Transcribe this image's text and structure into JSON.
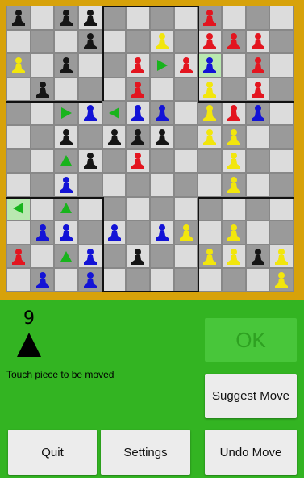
{
  "board": {
    "rows": 12,
    "cols": 12,
    "colors": {
      "light": "#dcdcdc",
      "dark": "#9a9a9a",
      "highlight": "#b9e8b0",
      "frame": "#d7a20a"
    },
    "pieces": [
      {
        "r": 0,
        "c": 0,
        "color": "black",
        "kind": "pawn"
      },
      {
        "r": 0,
        "c": 2,
        "color": "black",
        "kind": "pawn"
      },
      {
        "r": 0,
        "c": 3,
        "color": "black",
        "kind": "pawn"
      },
      {
        "r": 0,
        "c": 8,
        "color": "red",
        "kind": "pawn"
      },
      {
        "r": 1,
        "c": 3,
        "color": "black",
        "kind": "pawn"
      },
      {
        "r": 1,
        "c": 6,
        "color": "yellow",
        "kind": "pawn"
      },
      {
        "r": 1,
        "c": 8,
        "color": "red",
        "kind": "pawn"
      },
      {
        "r": 1,
        "c": 9,
        "color": "red",
        "kind": "pawn"
      },
      {
        "r": 1,
        "c": 10,
        "color": "red",
        "kind": "pawn"
      },
      {
        "r": 2,
        "c": 0,
        "color": "yellow",
        "kind": "pawn"
      },
      {
        "r": 2,
        "c": 2,
        "color": "black",
        "kind": "pawn"
      },
      {
        "r": 2,
        "c": 5,
        "color": "red",
        "kind": "pawn"
      },
      {
        "r": 2,
        "c": 6,
        "color": "green",
        "kind": "arrow-right"
      },
      {
        "r": 2,
        "c": 7,
        "color": "red",
        "kind": "pawn"
      },
      {
        "r": 2,
        "c": 8,
        "color": "blue",
        "kind": "pawn",
        "highlight": true
      },
      {
        "r": 2,
        "c": 10,
        "color": "red",
        "kind": "pawn"
      },
      {
        "r": 3,
        "c": 1,
        "color": "black",
        "kind": "pawn"
      },
      {
        "r": 3,
        "c": 5,
        "color": "red",
        "kind": "pawn"
      },
      {
        "r": 3,
        "c": 8,
        "color": "yellow",
        "kind": "pawn"
      },
      {
        "r": 3,
        "c": 10,
        "color": "red",
        "kind": "pawn"
      },
      {
        "r": 4,
        "c": 2,
        "color": "green",
        "kind": "arrow-right"
      },
      {
        "r": 4,
        "c": 3,
        "color": "blue",
        "kind": "pawn"
      },
      {
        "r": 4,
        "c": 4,
        "color": "green",
        "kind": "arrow-left"
      },
      {
        "r": 4,
        "c": 5,
        "color": "blue",
        "kind": "pawn"
      },
      {
        "r": 4,
        "c": 6,
        "color": "blue",
        "kind": "pawn"
      },
      {
        "r": 4,
        "c": 8,
        "color": "yellow",
        "kind": "pawn"
      },
      {
        "r": 4,
        "c": 9,
        "color": "red",
        "kind": "pawn"
      },
      {
        "r": 4,
        "c": 10,
        "color": "blue",
        "kind": "pawn"
      },
      {
        "r": 5,
        "c": 2,
        "color": "black",
        "kind": "pawn"
      },
      {
        "r": 5,
        "c": 4,
        "color": "black",
        "kind": "pawn"
      },
      {
        "r": 5,
        "c": 5,
        "color": "black",
        "kind": "pawn"
      },
      {
        "r": 5,
        "c": 6,
        "color": "black",
        "kind": "pawn"
      },
      {
        "r": 5,
        "c": 8,
        "color": "yellow",
        "kind": "pawn"
      },
      {
        "r": 5,
        "c": 9,
        "color": "yellow",
        "kind": "pawn"
      },
      {
        "r": 6,
        "c": 2,
        "color": "green",
        "kind": "arrow-up"
      },
      {
        "r": 6,
        "c": 3,
        "color": "black",
        "kind": "pawn"
      },
      {
        "r": 6,
        "c": 5,
        "color": "red",
        "kind": "pawn"
      },
      {
        "r": 6,
        "c": 9,
        "color": "yellow",
        "kind": "pawn"
      },
      {
        "r": 7,
        "c": 2,
        "color": "blue",
        "kind": "pawn"
      },
      {
        "r": 7,
        "c": 9,
        "color": "yellow",
        "kind": "pawn"
      },
      {
        "r": 8,
        "c": 0,
        "color": "green",
        "kind": "arrow-left",
        "highlight": true
      },
      {
        "r": 8,
        "c": 2,
        "color": "green",
        "kind": "arrow-up"
      },
      {
        "r": 9,
        "c": 1,
        "color": "blue",
        "kind": "pawn"
      },
      {
        "r": 9,
        "c": 2,
        "color": "blue",
        "kind": "pawn"
      },
      {
        "r": 9,
        "c": 4,
        "color": "blue",
        "kind": "pawn"
      },
      {
        "r": 9,
        "c": 6,
        "color": "blue",
        "kind": "pawn"
      },
      {
        "r": 9,
        "c": 7,
        "color": "yellow",
        "kind": "pawn"
      },
      {
        "r": 9,
        "c": 9,
        "color": "yellow",
        "kind": "pawn"
      },
      {
        "r": 10,
        "c": 0,
        "color": "red",
        "kind": "pawn"
      },
      {
        "r": 10,
        "c": 2,
        "color": "green",
        "kind": "arrow-up"
      },
      {
        "r": 10,
        "c": 3,
        "color": "blue",
        "kind": "pawn"
      },
      {
        "r": 10,
        "c": 5,
        "color": "black",
        "kind": "pawn"
      },
      {
        "r": 10,
        "c": 8,
        "color": "yellow",
        "kind": "pawn"
      },
      {
        "r": 10,
        "c": 9,
        "color": "yellow",
        "kind": "pawn"
      },
      {
        "r": 10,
        "c": 10,
        "color": "black",
        "kind": "pawn"
      },
      {
        "r": 10,
        "c": 11,
        "color": "yellow",
        "kind": "pawn"
      },
      {
        "r": 11,
        "c": 1,
        "color": "blue",
        "kind": "pawn"
      },
      {
        "r": 11,
        "c": 3,
        "color": "blue",
        "kind": "pawn"
      },
      {
        "r": 11,
        "c": 11,
        "color": "yellow",
        "kind": "pawn"
      }
    ],
    "piece_colors": {
      "black": "#151515",
      "red": "#e3151f",
      "yellow": "#f2e60c",
      "blue": "#1313d6",
      "green": "#18b41c"
    }
  },
  "status": {
    "move_count": "9",
    "turn_icon": "black-triangle-icon",
    "hint": "Touch piece to be moved"
  },
  "buttons": {
    "ok": "OK",
    "suggest": "Suggest Move",
    "quit": "Quit",
    "settings": "Settings",
    "undo": "Undo Move"
  }
}
